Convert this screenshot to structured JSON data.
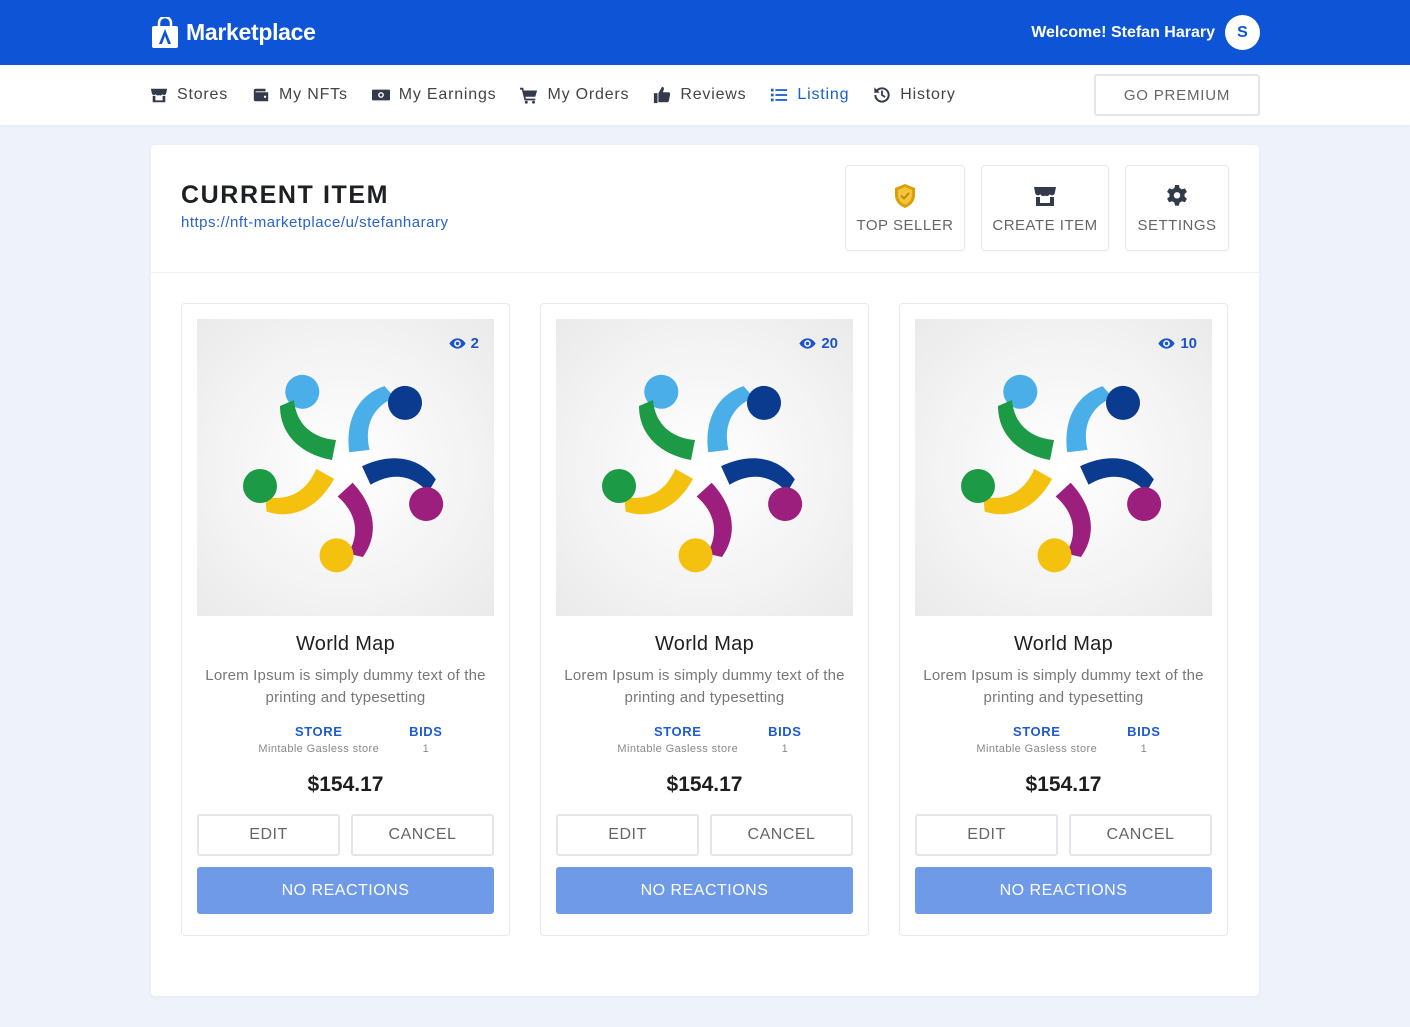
{
  "app": {
    "brand": "Marketplace",
    "brand_icon": "shopping-bag-icon",
    "welcome": "Welcome! Stefan Harary",
    "avatar_initial": "S",
    "colors": {
      "primary": "#0d55d6",
      "accent_button": "#6e9ae8",
      "background": "#eef3fb"
    }
  },
  "nav": {
    "items": [
      {
        "label": "Stores",
        "icon": "store-icon"
      },
      {
        "label": "My NFTs",
        "icon": "wallet-icon"
      },
      {
        "label": "My Earnings",
        "icon": "money-icon"
      },
      {
        "label": "My Orders",
        "icon": "cart-icon"
      },
      {
        "label": "Reviews",
        "icon": "thumbs-up-icon"
      },
      {
        "label": "Listing",
        "icon": "list-icon",
        "active": true
      },
      {
        "label": "History",
        "icon": "history-icon"
      }
    ],
    "premium": "GO PREMIUM"
  },
  "panel": {
    "title": "CURRENT ITEM",
    "link": "https://nft-marketplace/u/stefanharary",
    "actions": [
      {
        "label": "TOP SELLER",
        "icon": "shield-badge-icon"
      },
      {
        "label": "CREATE ITEM",
        "icon": "store-icon"
      },
      {
        "label": "SETTINGS",
        "icon": "gear-icon"
      }
    ]
  },
  "cards": [
    {
      "views": "2",
      "title": "World Map",
      "description": "Lorem Ipsum is simply dummy text of the printing and typesetting",
      "store_label": "STORE",
      "store_value": "Mintable Gasless store",
      "bids_label": "BIDS",
      "bids_value": "1",
      "price": "$154.17",
      "edit": "EDIT",
      "cancel": "CANCEL",
      "reactions": "NO REACTIONS"
    },
    {
      "views": "20",
      "title": "World Map",
      "description": "Lorem Ipsum is simply dummy text of the printing and typesetting",
      "store_label": "STORE",
      "store_value": "Mintable Gasless store",
      "bids_label": "BIDS",
      "bids_value": "1",
      "price": "$154.17",
      "edit": "EDIT",
      "cancel": "CANCEL",
      "reactions": "NO REACTIONS"
    },
    {
      "views": "10",
      "title": "World Map",
      "description": "Lorem Ipsum is simply dummy text of the printing and typesetting",
      "store_label": "STORE",
      "store_value": "Mintable Gasless store",
      "bids_label": "BIDS",
      "bids_value": "1",
      "price": "$154.17",
      "edit": "EDIT",
      "cancel": "CANCEL",
      "reactions": "NO REACTIONS"
    }
  ]
}
